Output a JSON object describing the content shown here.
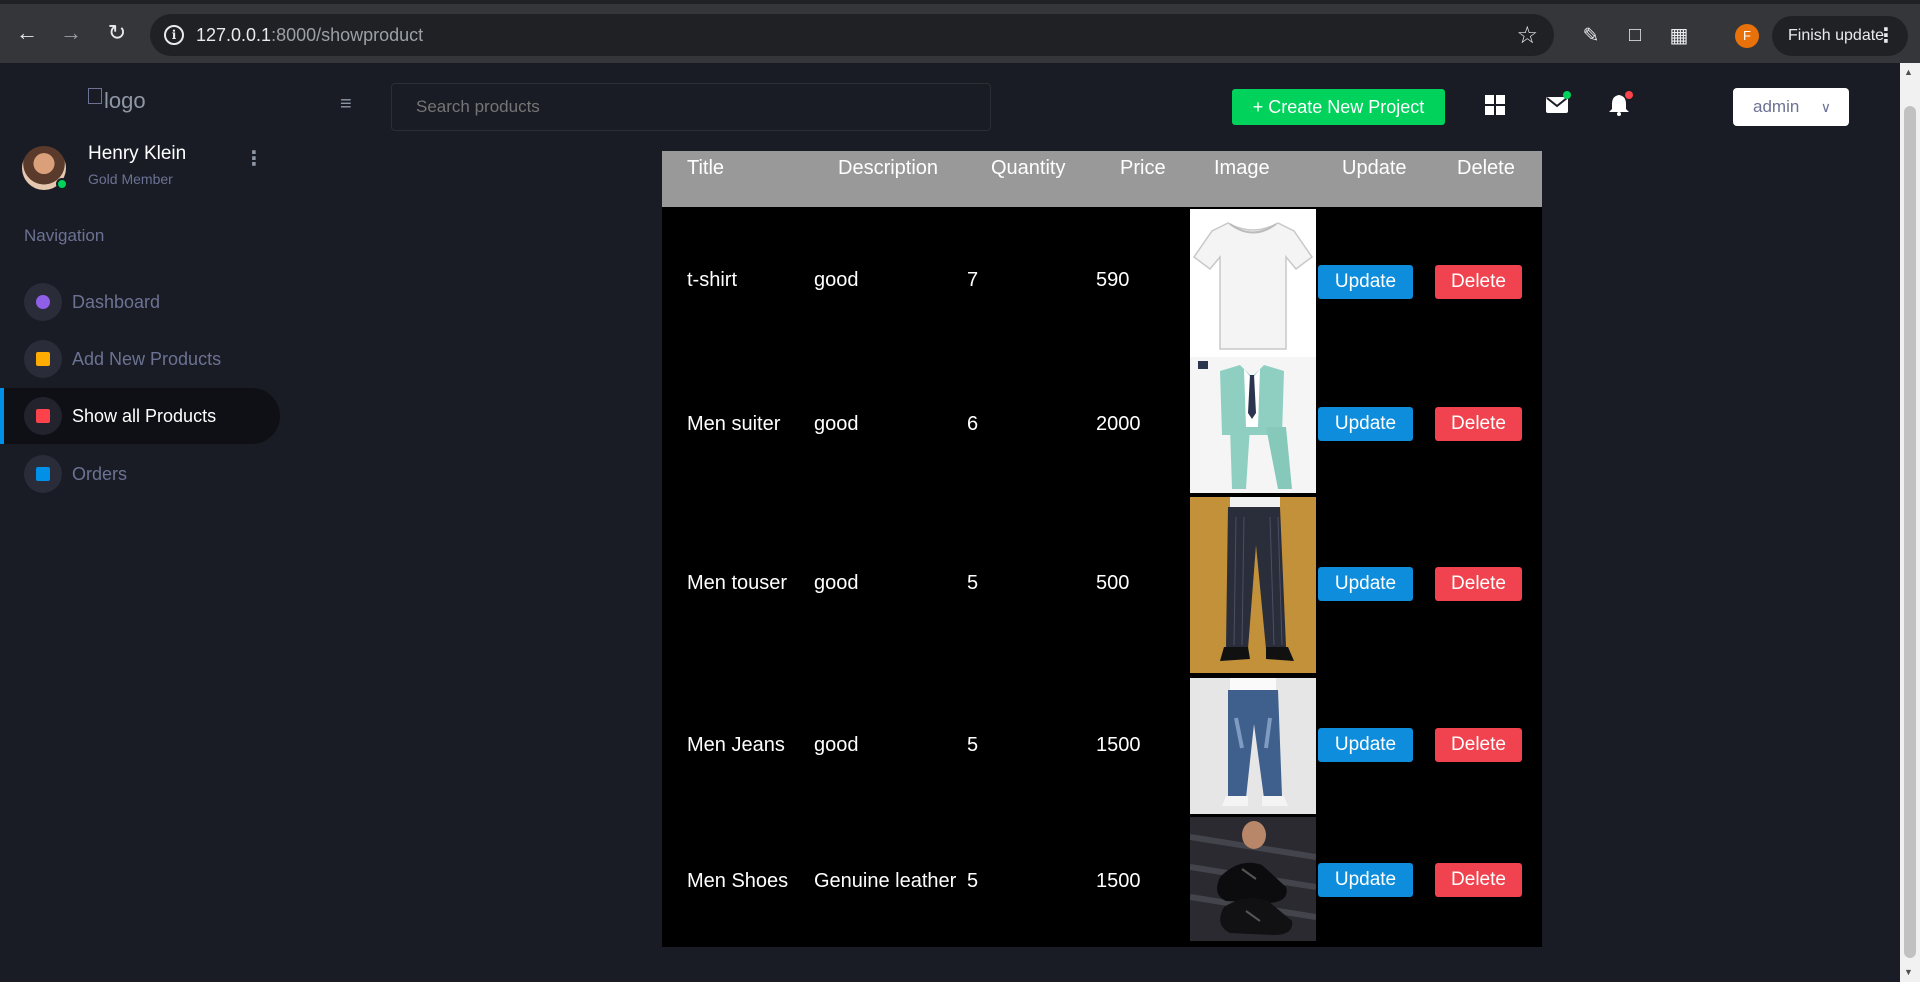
{
  "browser": {
    "url_host": "127.0.0.1",
    "url_path": ":8000/showproduct",
    "profile_initial": "F",
    "finish_update": "Finish update"
  },
  "sidebar": {
    "logo_alt": "logo",
    "profile": {
      "name": "Henry Klein",
      "rank": "Gold Member"
    },
    "nav_caption": "Navigation",
    "items": [
      {
        "label": "Dashboard",
        "icon": "speedometer-icon",
        "color": "#8f5fe8"
      },
      {
        "label": "Add New Products",
        "icon": "form-icon",
        "color": "#ffab00"
      },
      {
        "label": "Show all Products",
        "icon": "table-icon",
        "color": "#fc424a"
      },
      {
        "label": "Orders",
        "icon": "list-icon",
        "color": "#0090e7"
      }
    ]
  },
  "navbar": {
    "search_placeholder": "Search products",
    "create_label": "+ Create New Project",
    "user": "admin"
  },
  "table": {
    "headers": [
      "Title",
      "Description",
      "Quantity",
      "Price",
      "Image",
      "Update",
      "Delete"
    ],
    "rows": [
      {
        "title": "t-shirt",
        "description": "good",
        "quantity": "7",
        "price": "590",
        "image": "white-tshirt",
        "update": "Update",
        "delete": "Delete"
      },
      {
        "title": "Men suiter",
        "description": "good",
        "quantity": "6",
        "price": "2000",
        "image": "teal-suit",
        "update": "Update",
        "delete": "Delete"
      },
      {
        "title": "Men touser",
        "description": "good",
        "quantity": "5",
        "price": "500",
        "image": "striped-trousers",
        "update": "Update",
        "delete": "Delete"
      },
      {
        "title": "Men Jeans",
        "description": "good",
        "quantity": "5",
        "price": "1500",
        "image": "blue-jeans",
        "update": "Update",
        "delete": "Delete"
      },
      {
        "title": "Men Shoes",
        "description": "Genuine leather",
        "quantity": "5",
        "price": "1500",
        "image": "black-shoes",
        "update": "Update",
        "delete": "Delete"
      }
    ]
  },
  "colors": {
    "background": "#191c24",
    "create_button": "#00d25b",
    "update_button": "#0d8ddb",
    "delete_button": "#f0434f",
    "table_header": "#999999"
  }
}
